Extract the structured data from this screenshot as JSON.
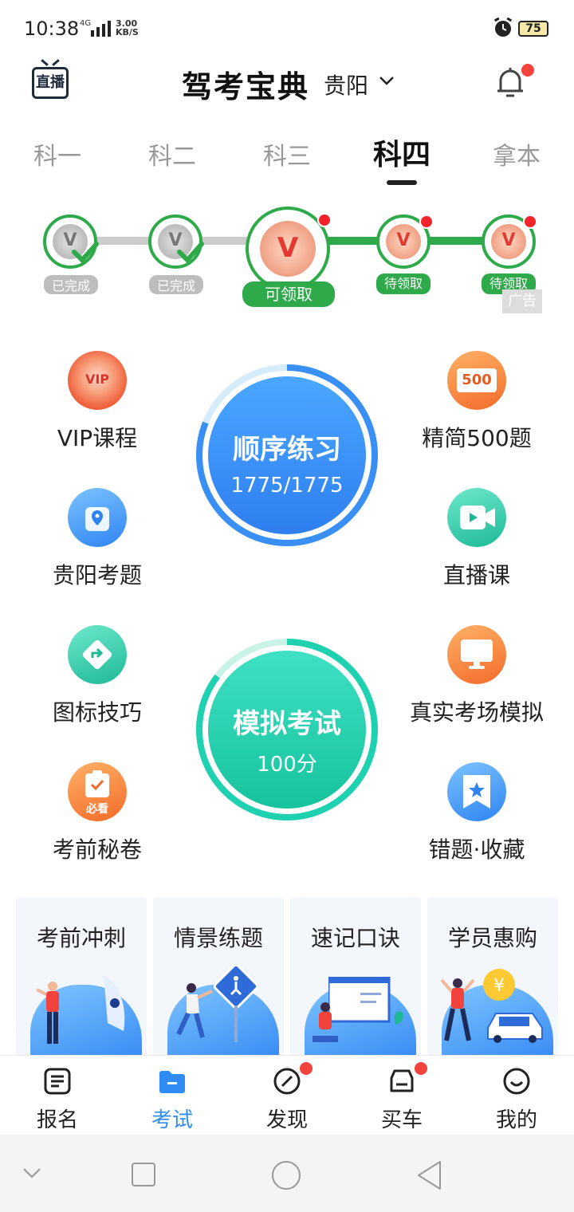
{
  "status_bar": {
    "time": "10:38",
    "network": "4G",
    "speed": "3.00\nKB/S",
    "battery": "75"
  },
  "header": {
    "live_label": "直播",
    "title": "驾考宝典",
    "city": "贵阳"
  },
  "tabs": [
    {
      "label": "科一"
    },
    {
      "label": "科二"
    },
    {
      "label": "科三"
    },
    {
      "label": "科四"
    },
    {
      "label": "拿本"
    }
  ],
  "progress": {
    "medals": [
      {
        "letter": "V",
        "status": "已完成"
      },
      {
        "letter": "V",
        "status": "已完成"
      },
      {
        "letter": "V",
        "status": "可领取"
      },
      {
        "letter": "V",
        "status": "待领取"
      },
      {
        "letter": "V",
        "status": "待领取"
      }
    ],
    "ad_tag": "广告"
  },
  "features": {
    "left": [
      {
        "label": "VIP课程",
        "badge": "VIP",
        "icon": "vip-medal-icon"
      },
      {
        "label": "贵阳考题",
        "icon": "location-icon"
      },
      {
        "label": "图标技巧",
        "icon": "traffic-sign-icon"
      },
      {
        "label": "考前秘卷",
        "badge": "必看",
        "icon": "clipboard-icon"
      }
    ],
    "right": [
      {
        "label": "精简500题",
        "badge": "500",
        "icon": "500-icon"
      },
      {
        "label": "直播课",
        "icon": "video-icon"
      },
      {
        "label": "真实考场模拟",
        "icon": "monitor-icon"
      },
      {
        "label": "错题·收藏",
        "icon": "star-bookmark-icon"
      }
    ]
  },
  "practice": {
    "title": "顺序练习",
    "progress_text": "1775/1775"
  },
  "exam": {
    "title": "模拟考试",
    "score_text": "100分"
  },
  "cards": [
    {
      "title": "考前冲刺"
    },
    {
      "title": "情景练题"
    },
    {
      "title": "速记口诀"
    },
    {
      "title": "学员惠购"
    }
  ],
  "bottom_nav": [
    {
      "label": "报名",
      "icon": "form-icon"
    },
    {
      "label": "考试",
      "icon": "folder-icon",
      "active": true
    },
    {
      "label": "发现",
      "icon": "compass-icon"
    },
    {
      "label": "买车",
      "icon": "car-icon"
    },
    {
      "label": "我的",
      "icon": "smile-icon"
    }
  ],
  "colors": {
    "accent": "#2f8cf3",
    "green": "#2eaa4a",
    "red_dot": "#f2433c",
    "practice_blue": "#3a8ff5",
    "exam_green": "#1fcfa8"
  }
}
